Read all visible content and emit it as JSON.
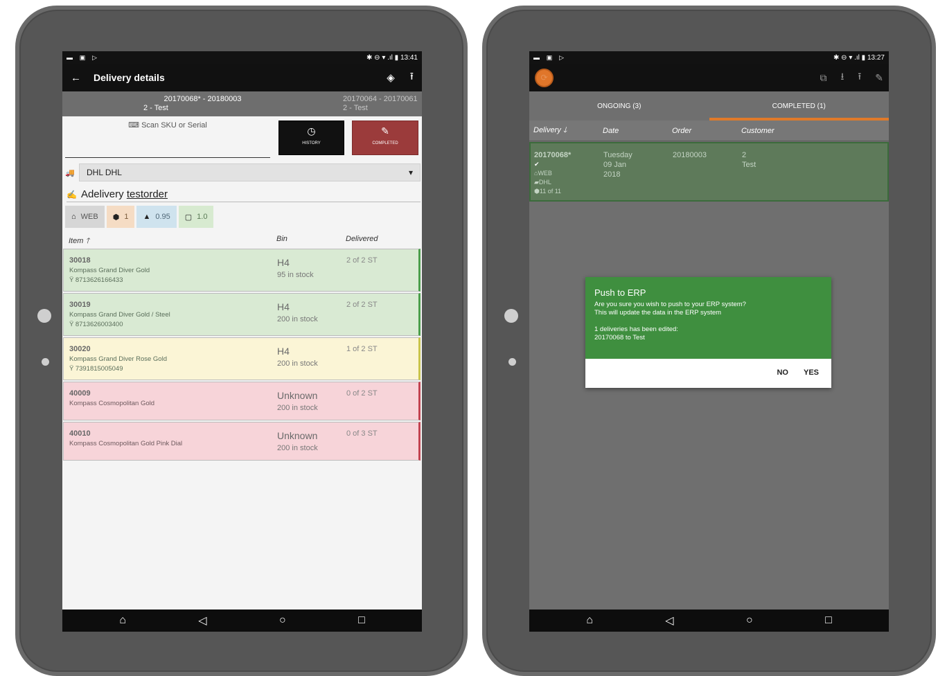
{
  "left": {
    "status": {
      "time": "13:41",
      "left_icons": [
        "▬",
        "▣",
        "▷"
      ],
      "right_icons": "✱ ⊖ ▾ .ıl ▮"
    },
    "appbar": {
      "title": "Delivery details",
      "back_icon": "←",
      "tag_icon": "◈",
      "upload_icon": "⭱"
    },
    "orders": {
      "current_line1": "20170068* - 20180003",
      "current_line2": "2 - Test",
      "next_line1": "20170064 - 20170061",
      "next_line2": "2 - Test"
    },
    "scan": {
      "placeholder": "Scan SKU or Serial",
      "icon": "⌨"
    },
    "buttons": {
      "history": "HISTORY",
      "history_icon": "◷",
      "completed": "COMPLETED",
      "completed_icon": "✎"
    },
    "carrier": {
      "value": "DHL DHL",
      "icon": "🚚",
      "arrow": "▾"
    },
    "order_name": {
      "prefix": "Adelivery",
      "name": "testorder",
      "icon": "✍"
    },
    "tags": {
      "web": "WEB",
      "boxes": "1",
      "weight": "0.95",
      "volume": "1.0"
    },
    "table": {
      "headers": {
        "item": "Item",
        "item_arrow": "🡑",
        "bin": "Bin",
        "delivered": "Delivered"
      },
      "rows": [
        {
          "code": "30018",
          "desc": "Kompass Grand Diver Gold",
          "ean": "8713626166433",
          "bin": "H4",
          "stock": "95 in stock",
          "delivered": "2 of 2 ST",
          "state": "g"
        },
        {
          "code": "30019",
          "desc": "Kompass Grand Diver Gold / Steel",
          "ean": "8713626003400",
          "bin": "H4",
          "stock": "200 in stock",
          "delivered": "2 of 2 ST",
          "state": "g"
        },
        {
          "code": "30020",
          "desc": "Kompass Grand Diver Rose Gold",
          "ean": "7391815005049",
          "bin": "H4",
          "stock": "200 in stock",
          "delivered": "1 of 2 ST",
          "state": "y"
        },
        {
          "code": "40009",
          "desc": "Kompass Cosmopolitan Gold",
          "ean": "",
          "bin": "Unknown",
          "stock": "200 in stock",
          "delivered": "0 of 2 ST",
          "state": "r"
        },
        {
          "code": "40010",
          "desc": "Kompass Cosmopolitan Gold Pink Dial",
          "ean": "",
          "bin": "Unknown",
          "stock": "200 in stock",
          "delivered": "0 of 3 ST",
          "state": "r"
        }
      ]
    }
  },
  "right": {
    "status": {
      "time": "13:27",
      "right_icons": "✱ ⊖ ▾ .ıl ▮"
    },
    "appbar": {
      "icons": [
        "⧉",
        "⭳",
        "⭱",
        "✎"
      ]
    },
    "tabs": {
      "ongoing": "ONGOING (3)",
      "completed": "COMPLETED (1)"
    },
    "list": {
      "headers": {
        "delivery": "Delivery",
        "delivery_arrow": "🡓",
        "date": "Date",
        "order": "Order",
        "customer": "Customer"
      },
      "row": {
        "delivery": "20170068*",
        "check": "✔",
        "web": "WEB",
        "carrier": "DHL",
        "count": "11 of 11",
        "day": "Tuesday",
        "date": "09 Jan",
        "year": "2018",
        "order": "20180003",
        "customer_id": "2",
        "customer": "Test"
      }
    },
    "dialog": {
      "title": "Push to ERP",
      "line1": "Are you sure you wish to push to your ERP system?",
      "line2": "This will update the data in the ERP system",
      "line3": "1 deliveries has been edited:",
      "line4": "20170068 to Test",
      "no": "NO",
      "yes": "YES"
    }
  },
  "navbar": {
    "home": "⌂",
    "back": "◁",
    "circle": "○",
    "square": "□"
  },
  "colors": {
    "complete_green": "#d9ead3",
    "partial_yellow": "#fbf5d6",
    "missing_red": "#f7d4d9",
    "accent_orange": "#e07a2a",
    "dialog_green": "#3f8f3f",
    "completed_button": "#9b3b3b"
  }
}
